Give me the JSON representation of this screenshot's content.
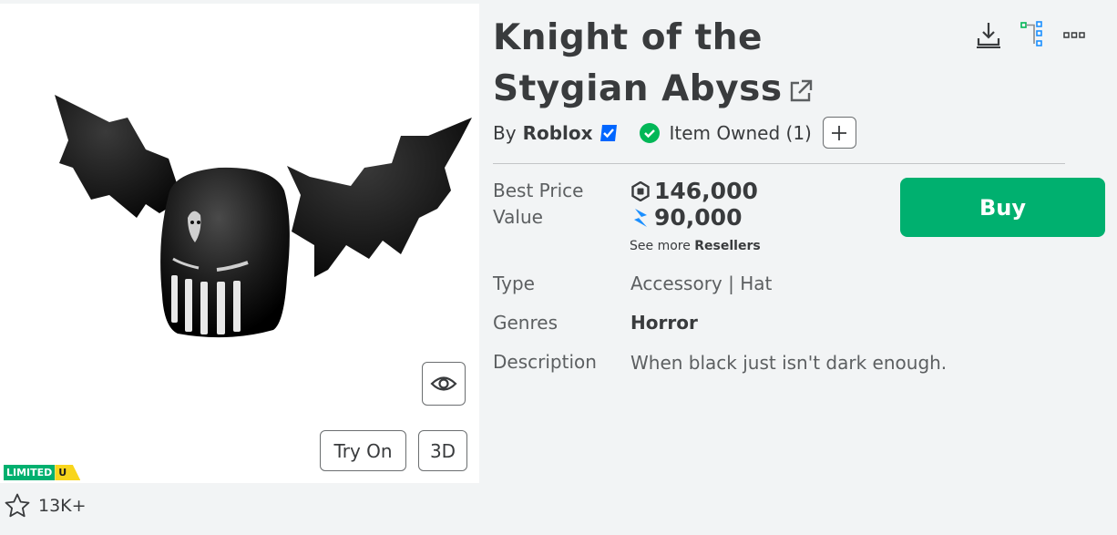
{
  "item": {
    "title": "Knight of the Stygian Abyss",
    "by_prefix": "By",
    "creator": "Roblox",
    "owned_text": "Item Owned (1)",
    "limited_badge": "LIMITED",
    "limited_suffix": "U",
    "favorites": "13K+"
  },
  "buttons": {
    "try_on": "Try On",
    "three_d": "3D",
    "buy": "Buy"
  },
  "pricing": {
    "best_price_label": "Best Price",
    "value_label": "Value",
    "best_price": "146,000",
    "value": "90,000",
    "see_more_prefix": "See more",
    "resellers": "Resellers"
  },
  "details": {
    "type_label": "Type",
    "type_value": "Accessory | Hat",
    "genres_label": "Genres",
    "genres_value": "Horror",
    "description_label": "Description",
    "description_value": "When black just isn't dark enough."
  },
  "icons": {
    "download": "download-icon",
    "tree": "hierarchy-icon",
    "more": "more-icon",
    "external": "external-link-icon",
    "verified": "verified-badge-icon",
    "owned": "check-circle-icon",
    "plus": "plus-icon",
    "eye": "eye-icon",
    "star": "star-icon",
    "robux": "robux-icon",
    "value": "value-bolt-icon"
  },
  "colors": {
    "buy_green": "#00b06f",
    "owned_green": "#02b757",
    "verified_blue": "#0066ff",
    "limited_yellow": "#f8d51c",
    "value_blue": "#1b8fff"
  }
}
